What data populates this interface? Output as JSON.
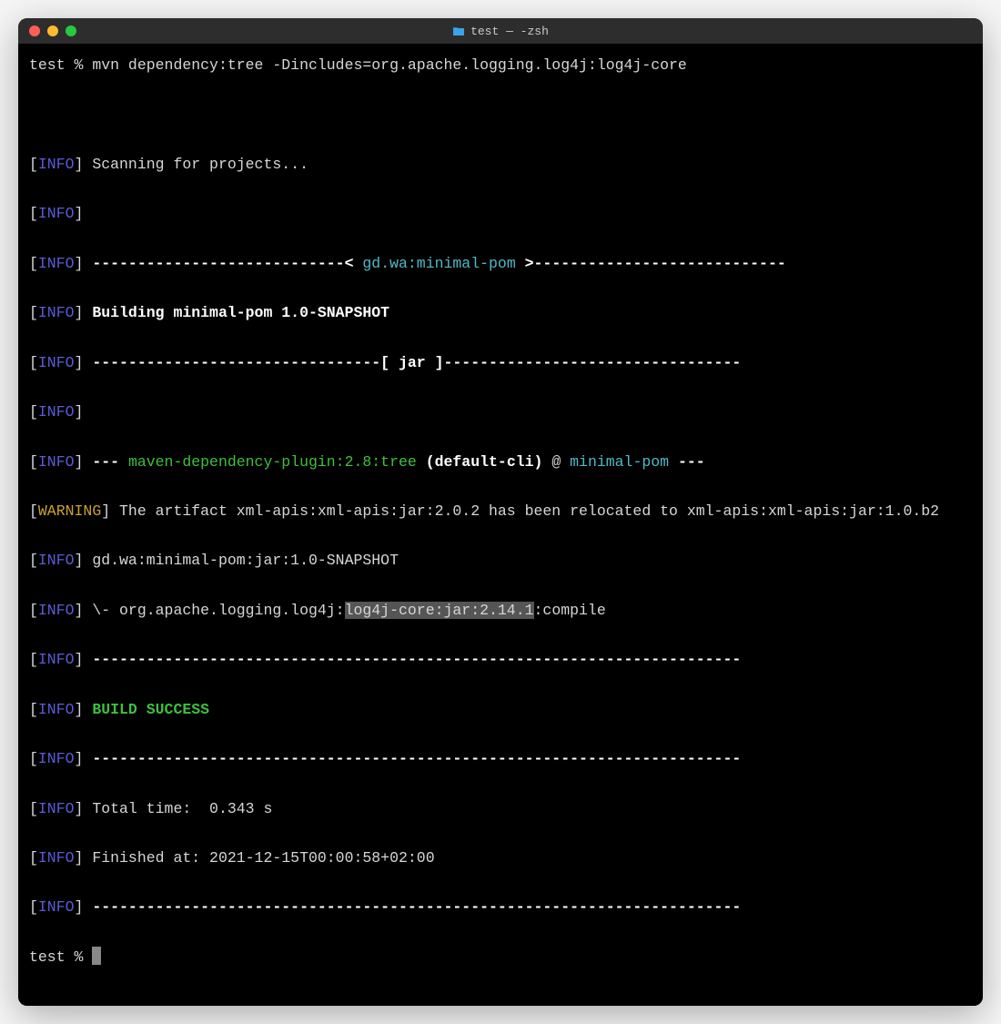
{
  "window": {
    "title": "test — -zsh"
  },
  "prompt": {
    "dir": "test",
    "symbol": "%",
    "command": "mvn dependency:tree -Dincludes=org.apache.logging.log4j:log4j-core"
  },
  "tags": {
    "info": "INFO",
    "warning": "WARNING"
  },
  "lines": {
    "scanning": "Scanning for projects...",
    "header_dash_left": "----------------------------< ",
    "header_project": "gd.wa:minimal-pom",
    "header_dash_right": " >----------------------------",
    "building": "Building minimal-pom 1.0-SNAPSHOT",
    "jar_dash_left": "--------------------------------[ ",
    "jar_text": "jar",
    "jar_dash_right": " ]---------------------------------",
    "plugin_prefix": "--- ",
    "plugin_name": "maven-dependency-plugin:2.8:tree",
    "plugin_mid": " (default-cli)",
    "plugin_at": " @ ",
    "plugin_target": "minimal-pom",
    "plugin_suffix": " ---",
    "warning_text": "The artifact xml-apis:xml-apis:jar:2.0.2 has been relocated to xml-apis:xml-apis:jar:1.0.b2",
    "tree_root": "gd.wa:minimal-pom:jar:1.0-SNAPSHOT",
    "tree_child_prefix": "\\- org.apache.logging.log4j:",
    "tree_child_highlight": "log4j-core:jar:2.14.1",
    "tree_child_suffix": ":compile",
    "rule72": "------------------------------------------------------------------------",
    "build_success": "BUILD SUCCESS",
    "total_time": "Total time:  0.343 s",
    "finished_at": "Finished at: 2021-12-15T00:00:58+02:00"
  },
  "prompt2": {
    "dir": "test",
    "symbol": "%"
  }
}
